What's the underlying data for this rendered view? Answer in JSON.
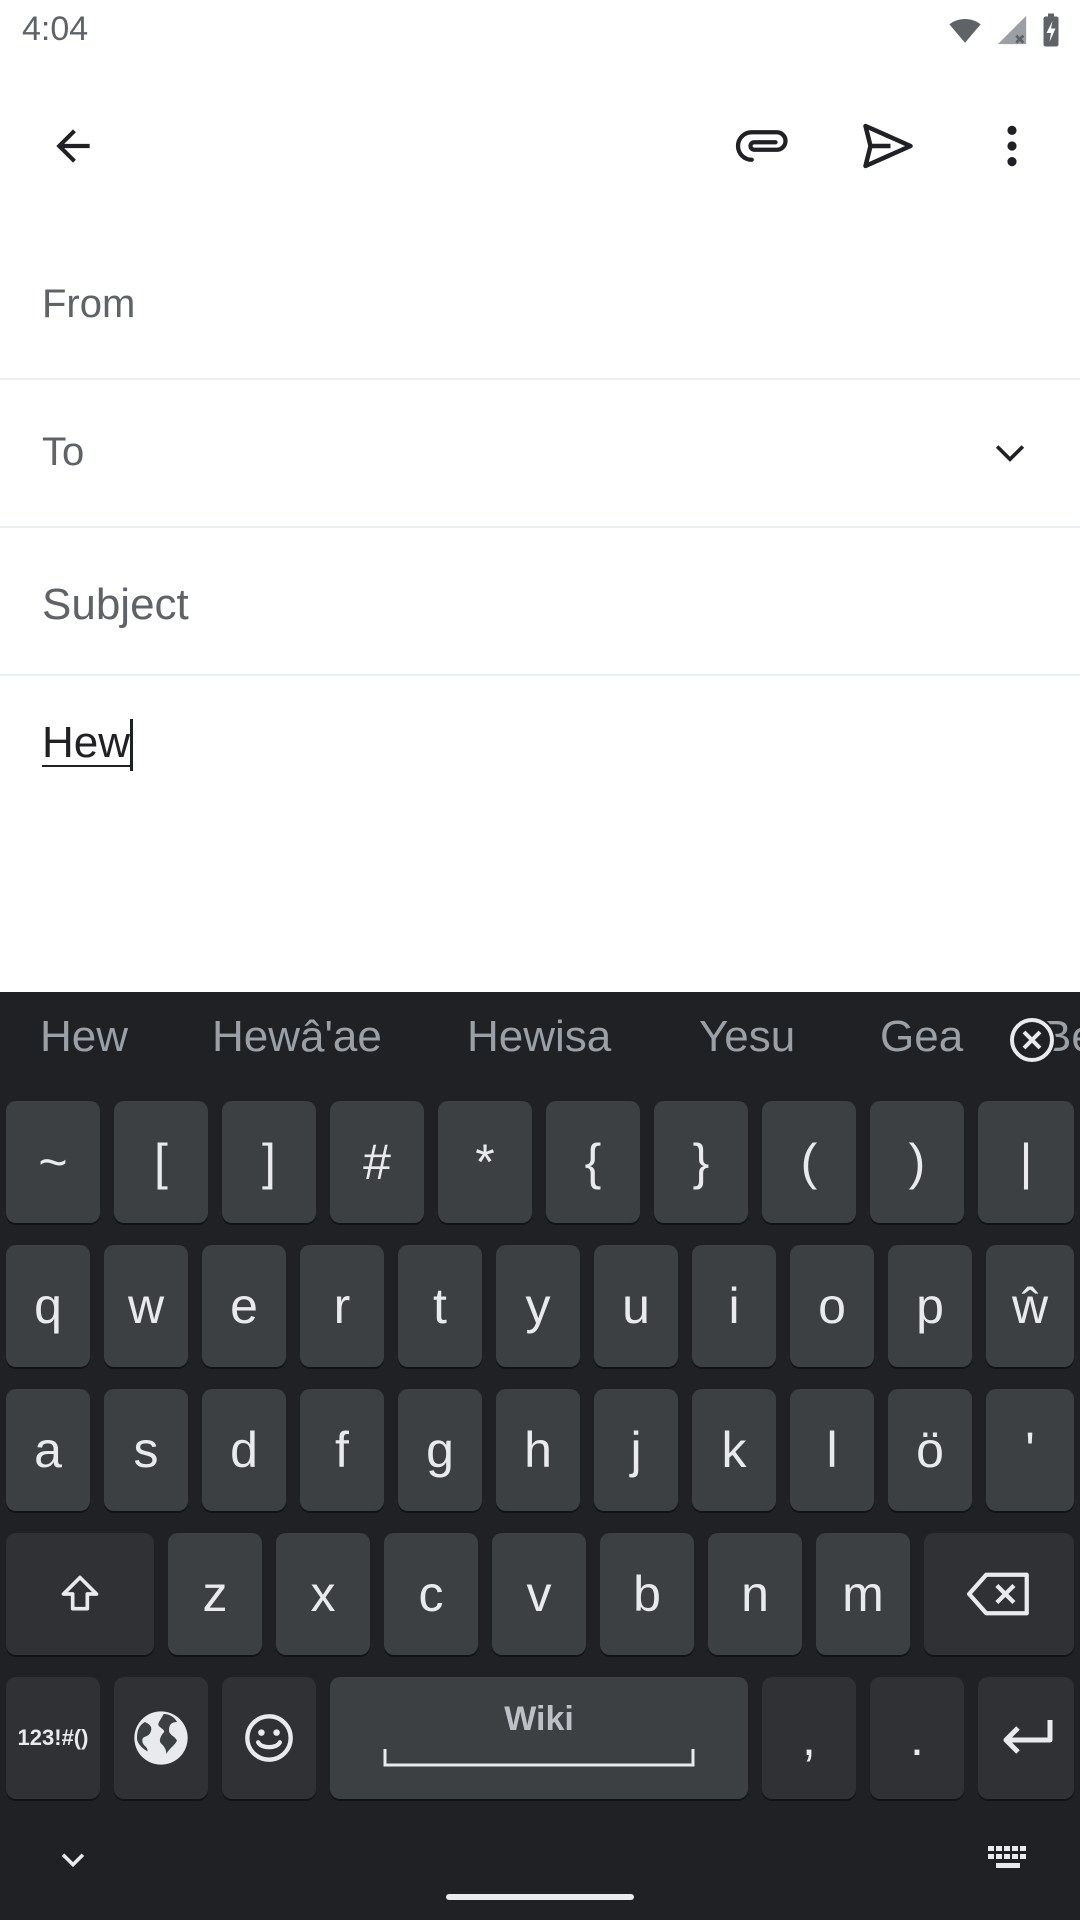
{
  "status": {
    "time": "4:04"
  },
  "toolbar": {
    "icons": [
      "back-icon",
      "attach-icon",
      "send-icon",
      "more-vert-icon"
    ]
  },
  "compose": {
    "from_label": "From",
    "to_label": "To",
    "subject_placeholder": "Subject",
    "body_text": "Hew"
  },
  "keyboard": {
    "suggestions": [
      "Hew",
      "Hewâ'ae",
      "Hewisa",
      "Yesu",
      "Gea",
      "Be"
    ],
    "row1": [
      "~",
      "[",
      "]",
      "#",
      "*",
      "{",
      "}",
      "(",
      ")",
      "|"
    ],
    "row2": [
      "q",
      "w",
      "e",
      "r",
      "t",
      "y",
      "u",
      "i",
      "o",
      "p",
      "ŵ"
    ],
    "row3": [
      "a",
      "s",
      "d",
      "f",
      "g",
      "h",
      "j",
      "k",
      "l",
      "ö",
      "'"
    ],
    "row4": [
      "z",
      "x",
      "c",
      "v",
      "b",
      "n",
      "m"
    ],
    "symbols_label": "123!#()",
    "space_label": "Wiki",
    "comma": ",",
    "period": "."
  },
  "colors": {
    "keyboard_bg": "#202124",
    "key_bg": "#3c4043"
  }
}
